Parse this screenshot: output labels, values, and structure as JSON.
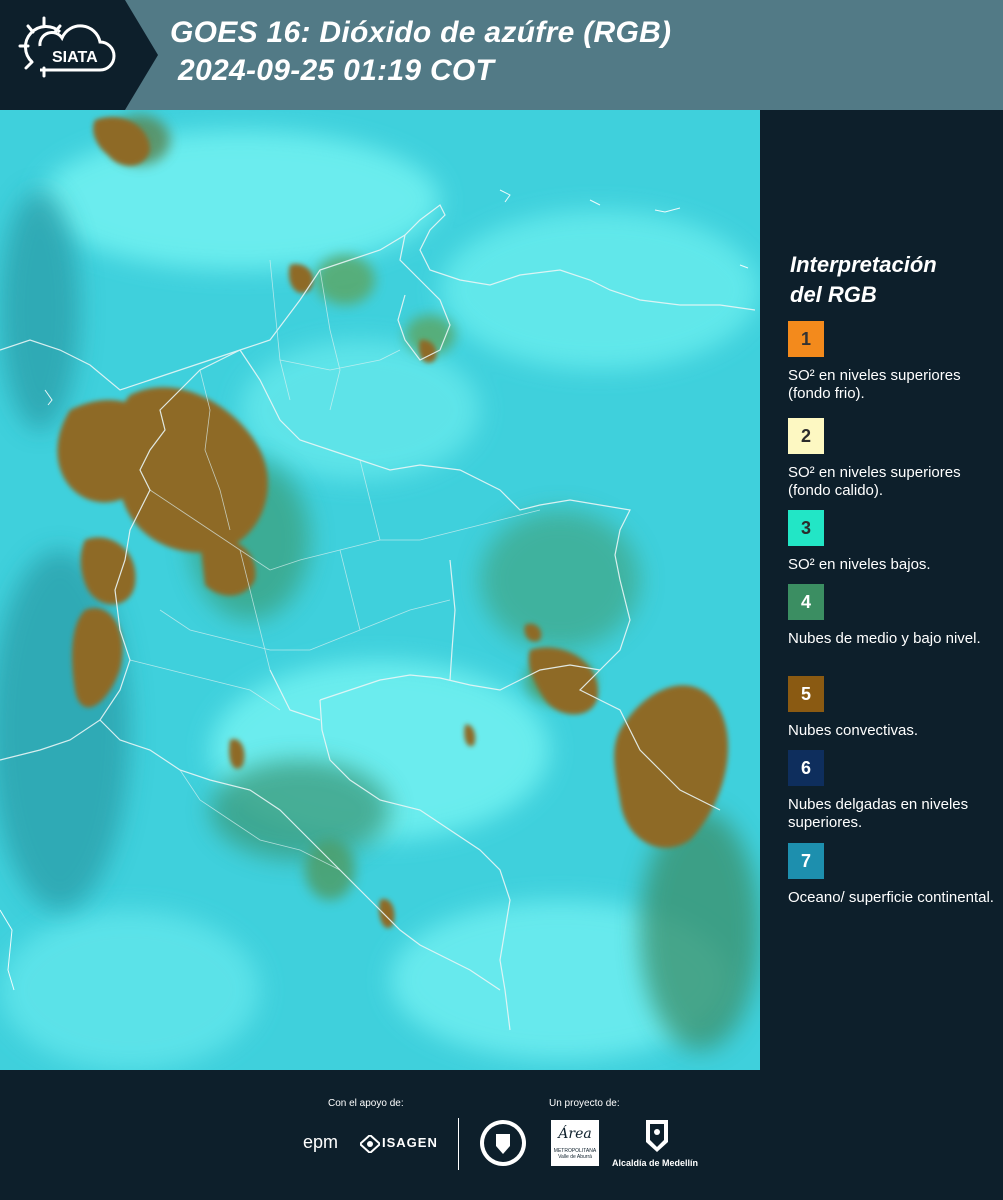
{
  "header": {
    "logo_text": "SIATA",
    "title_line1": "GOES 16: Dióxido de azúfre (RGB)",
    "title_line2": "2024-09-25 01:19 COT"
  },
  "legend": {
    "title_line1": "Interpretación",
    "title_line2": "del RGB",
    "items": [
      {
        "num": "1",
        "text": "SO² en niveles superiores (fondo frio).",
        "color": "#f38a1c"
      },
      {
        "num": "2",
        "text": "SO² en niveles superiores (fondo calido).",
        "color": "#fdf8c2"
      },
      {
        "num": "3",
        "text": "SO² en niveles bajos.",
        "color": "#22e6c6"
      },
      {
        "num": "4",
        "text": "Nubes de medio y bajo nivel.",
        "color": "#3b8e62"
      },
      {
        "num": "5",
        "text": "Nubes convectivas.",
        "color": "#8a5a12"
      },
      {
        "num": "6",
        "text": "Nubes delgadas en niveles superiores.",
        "color": "#0e2e5d"
      },
      {
        "num": "7",
        "text": "Oceano/ superficie continental.",
        "color": "#1d8fae"
      }
    ]
  },
  "footer": {
    "support_label": "Con el apoyo de:",
    "project_label": "Un proyecto de:",
    "epm": "epm",
    "isagen": "ISAGEN",
    "area_line1": "METROPOLITANA",
    "area_line2": "Valle de Aburrá",
    "area_script": "Área",
    "alcaldia": "Alcaldía de Medellín"
  }
}
